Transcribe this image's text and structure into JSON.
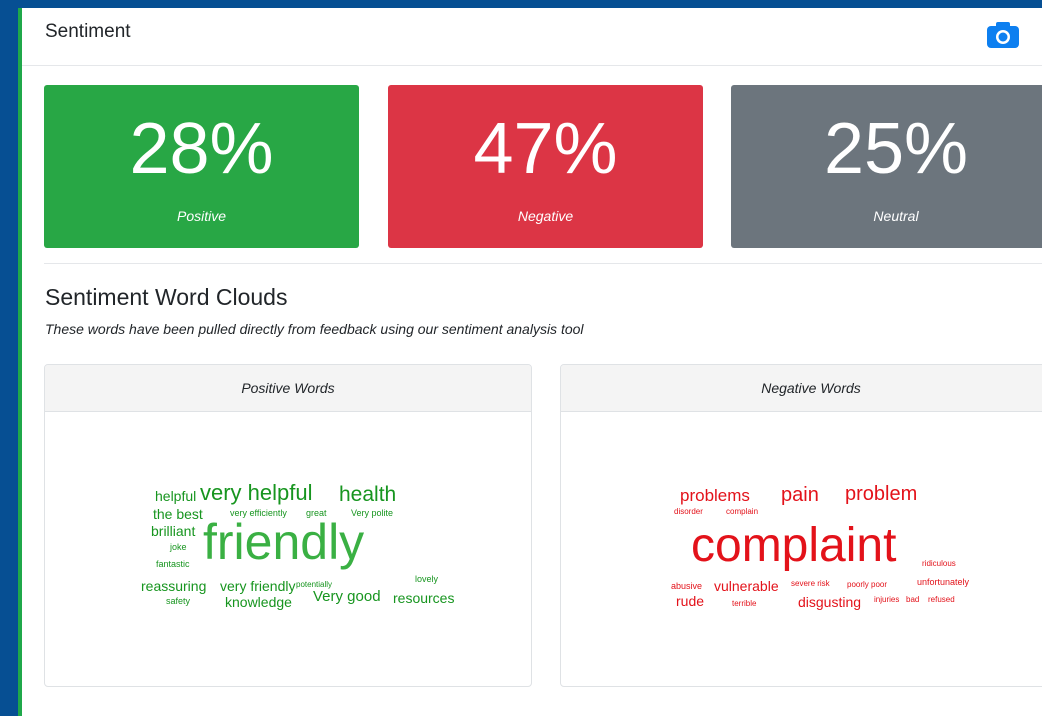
{
  "header": {
    "title": "Sentiment",
    "camera_icon": "camera-icon"
  },
  "stats": {
    "positive": {
      "value": "28%",
      "label": "Positive",
      "color": "#28a745"
    },
    "negative": {
      "value": "47%",
      "label": "Negative",
      "color": "#dc3545"
    },
    "neutral": {
      "value": "25%",
      "label": "Neutral",
      "color": "#6c757d"
    }
  },
  "word_clouds": {
    "title": "Sentiment Word Clouds",
    "subtitle": "These words have been pulled directly from feedback using our sentiment analysis tool",
    "positive": {
      "header": "Positive Words",
      "words": [
        "helpful",
        "very helpful",
        "health",
        "the best",
        "very efficiently",
        "great",
        "Very polite",
        "brilliant",
        "joke",
        "friendly",
        "fantastic",
        "lovely",
        "reassuring",
        "very friendly",
        "potentially",
        "safety",
        "knowledge",
        "Very good",
        "resources"
      ]
    },
    "negative": {
      "header": "Negative Words",
      "words": [
        "problems",
        "pain",
        "problem",
        "disorder",
        "complain",
        "complaint",
        "ridiculous",
        "abusive",
        "vulnerable",
        "severe risk",
        "poorly poor",
        "unfortunately",
        "rude",
        "terrible",
        "disgusting",
        "injuries",
        "bad",
        "refused"
      ]
    }
  }
}
